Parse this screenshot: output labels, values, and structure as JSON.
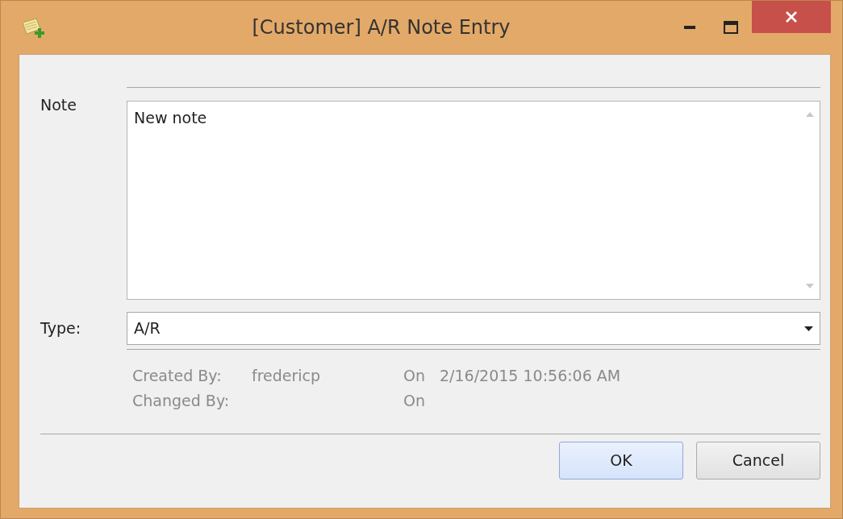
{
  "window": {
    "title": "[Customer] A/R Note Entry"
  },
  "note": {
    "label": "Note",
    "value": "New note"
  },
  "type": {
    "label": "Type:",
    "value": "A/R"
  },
  "info": [
    {
      "label": "Created By:",
      "value": "fredericp",
      "on_label": "On",
      "on_value": "2/16/2015 10:56:06 AM"
    },
    {
      "label": "Changed By:",
      "on_label": "On"
    }
  ],
  "buttons": [
    {
      "label": "OK",
      "default": true
    },
    {
      "label": "Cancel",
      "default": false
    }
  ]
}
